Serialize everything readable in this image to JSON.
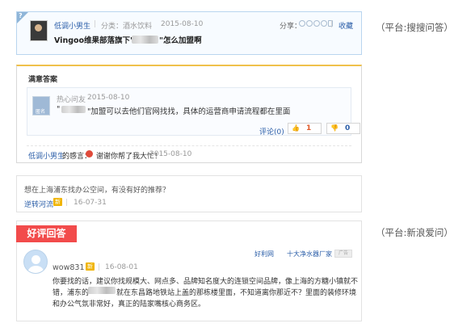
{
  "card1": {
    "corner_mark": "?",
    "asker_name": "低调小男生",
    "separator": "|",
    "category": "分类：酒水饮料",
    "date": "2015-08-10",
    "share_label": "分享：",
    "share_icons": [
      "search-icon",
      "weibo-icon",
      "qzone-icon",
      "renren-icon",
      "more-icon"
    ],
    "favorite_label": "收藏",
    "question_prefix": "Vingoo维果部落旗下\"",
    "question_suffix": "\"怎么加盟啊"
  },
  "platform_label_1": "（平台:搜搜问答）",
  "card2": {
    "heading": "满意答案",
    "avatar_label": "匿名",
    "answer_user": "热心问友",
    "answer_date": "2015-08-10",
    "answer_quote_open": "\"",
    "answer_text": "\"加盟可以去他们官网找找，具体的运营商申请流程都在里面",
    "comment_link": "评论(0)",
    "like_count": "1",
    "dislike_count": "0",
    "thanks_user": "低调小男生",
    "thanks_label": "的感言：",
    "thanks_text": "谢谢你帮了我大忙！",
    "thanks_date": "2015-08-10"
  },
  "card3": {
    "question": "想在上海浦东找办公空间，有没有好的推荐？",
    "user": "逆转河流",
    "badge": "新",
    "separator": "|",
    "date": "16-07-31"
  },
  "card4": {
    "good_badge": "好评回答",
    "ad_link_1": "好利网",
    "ad_link_2": "十大净水器厂家",
    "ad_close": "广告",
    "user": "wow831",
    "badge": "新",
    "separator": "|",
    "date": "16-08-01",
    "line1": "你要找的话，建议你找规模大、网点多、品牌知名度大的连锁空间品牌，像上海的方糖小镇就不",
    "line2_prefix": "错，浦东的",
    "line2_suffix": "就在东昌路地铁站上盖的那栋楼里面，不知道离你那近不？里面的装修环境",
    "line3": "和办公气氛非常好，真正的陆家嘴核心商务区。"
  },
  "platform_label_2": "（平台:新浪爱问）",
  "colors": {
    "link_blue": "#2b5ea8",
    "badge_red": "#f24b4b",
    "badge_orange": "#f0b400",
    "card1_border": "#b9d5ef",
    "card2_top": "#f0c14b"
  }
}
